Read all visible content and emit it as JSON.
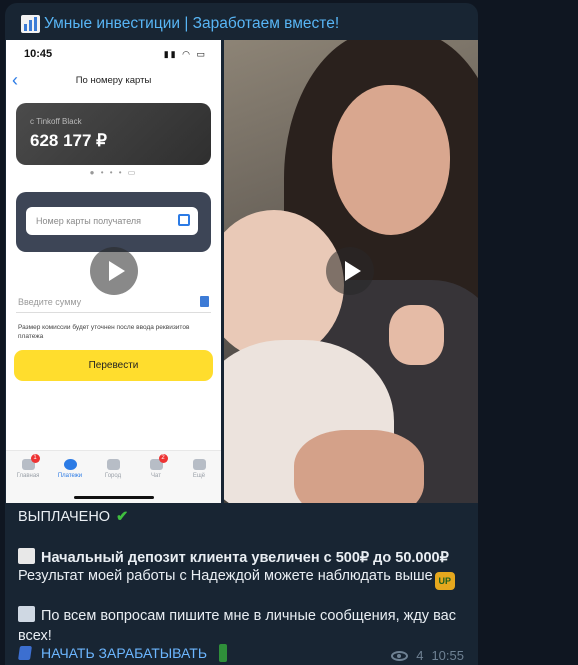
{
  "channel": {
    "title": "Умные инвестиции | Заработаем вместе!"
  },
  "phone_screen": {
    "time": "10:45",
    "title": "По номеру карты",
    "card_label": "с Tinkoff Black",
    "card_amount": "628 177 ₽",
    "recipient_placeholder": "Номер карты получателя",
    "amount_placeholder": "Введите сумму",
    "commission_hint": "Размер комиссии будет уточнен после ввода реквизитов платежа",
    "transfer_button": "Перевести",
    "tabs": [
      {
        "label": "Главная",
        "badge": "1"
      },
      {
        "label": "Платежи",
        "badge": ""
      },
      {
        "label": "Город",
        "badge": ""
      },
      {
        "label": "Чат",
        "badge": "2"
      },
      {
        "label": "Ещё",
        "badge": ""
      }
    ]
  },
  "message": {
    "paid": "ВЫПЛАЧЕНО",
    "paid_icon": "✔",
    "deposit_line": "Начальный депозит клиента увеличен с 500₽ до 50.000₽",
    "result_line": "Результат моей работы с Надеждой можете наблюдать выше",
    "up_icon": "UP",
    "contact_line": "По всем вопросам пишите мне в личные сообщения, жду вас всех!",
    "cta": "НАЧАТЬ ЗАРАБАТЫВАТЬ"
  },
  "meta": {
    "views": "4",
    "time": "10:55"
  },
  "colors": {
    "background": "#0f1621",
    "bubble": "#182533",
    "link": "#58b5f5",
    "check": "#3fbf3f"
  }
}
